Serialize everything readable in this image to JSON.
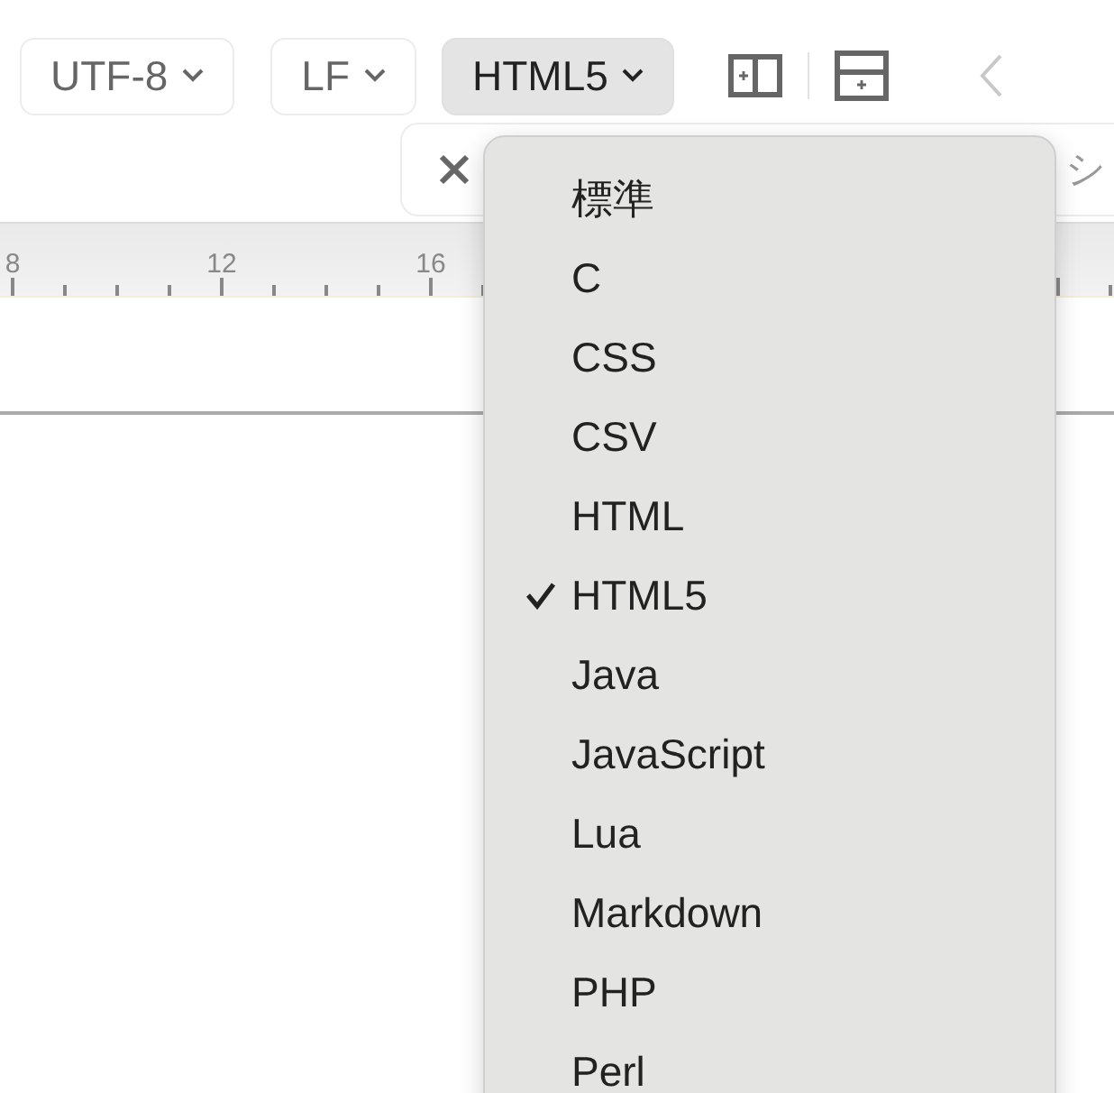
{
  "toolbar": {
    "buttons": [
      {
        "label": "UTF-8",
        "selected": false
      },
      {
        "label": "LF",
        "selected": false
      },
      {
        "label": "HTML5",
        "selected": true
      }
    ]
  },
  "find_bar": {
    "partial_text": "シ"
  },
  "ruler": {
    "labels": [
      "8",
      "12",
      "16"
    ]
  },
  "menu": {
    "items": [
      {
        "label": "標準",
        "checked": false
      },
      {
        "label": "C",
        "checked": false
      },
      {
        "label": "CSS",
        "checked": false
      },
      {
        "label": "CSV",
        "checked": false
      },
      {
        "label": "HTML",
        "checked": false
      },
      {
        "label": "HTML5",
        "checked": true
      },
      {
        "label": "Java",
        "checked": false
      },
      {
        "label": "JavaScript",
        "checked": false
      },
      {
        "label": "Lua",
        "checked": false
      },
      {
        "label": "Markdown",
        "checked": false
      },
      {
        "label": "PHP",
        "checked": false
      },
      {
        "label": "Perl",
        "checked": false
      }
    ]
  }
}
